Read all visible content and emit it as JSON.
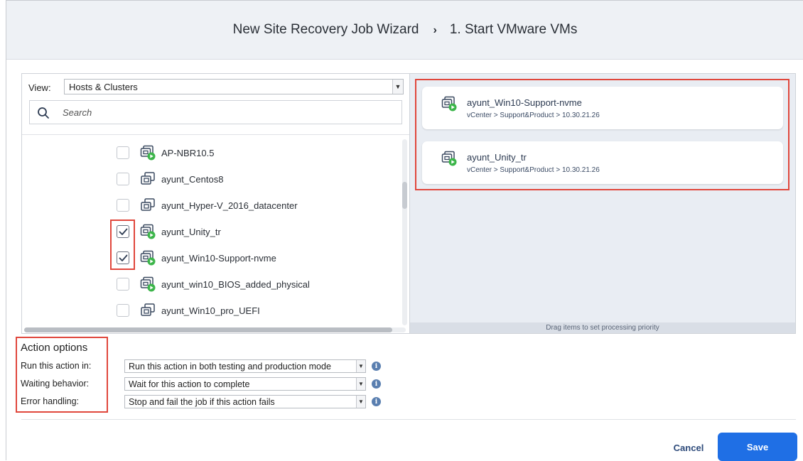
{
  "header": {
    "wizard_title": "New Site Recovery Job Wizard",
    "separator": "›",
    "step_title": "1. Start VMware VMs"
  },
  "inventory": {
    "view_label": "View:",
    "view_value": "Hosts & Clusters",
    "search_placeholder": "Search",
    "items": [
      {
        "name": "AP-NBR10.5",
        "checked": false,
        "powered_on": true
      },
      {
        "name": "ayunt_Centos8",
        "checked": false,
        "powered_on": false
      },
      {
        "name": "ayunt_Hyper-V_2016_datacenter",
        "checked": false,
        "powered_on": false
      },
      {
        "name": "ayunt_Unity_tr",
        "checked": true,
        "powered_on": true
      },
      {
        "name": "ayunt_Win10-Support-nvme",
        "checked": true,
        "powered_on": true
      },
      {
        "name": "ayunt_win10_BIOS_added_physical",
        "checked": false,
        "powered_on": true
      },
      {
        "name": "ayunt_Win10_pro_UEFI",
        "checked": false,
        "powered_on": false
      }
    ]
  },
  "selected": {
    "items": [
      {
        "name": "ayunt_Win10-Support-nvme",
        "path": "vCenter > Support&Product > 10.30.21.26"
      },
      {
        "name": "ayunt_Unity_tr",
        "path": "vCenter > Support&Product > 10.30.21.26"
      }
    ],
    "drag_hint": "Drag items to set processing priority"
  },
  "action_options": {
    "title": "Action options",
    "run_label": "Run this action in:",
    "run_value": "Run this action in both testing and production mode",
    "waiting_label": "Waiting behavior:",
    "waiting_value": "Wait for this action to complete",
    "error_label": "Error handling:",
    "error_value": "Stop and fail the job if this action fails"
  },
  "footer": {
    "cancel_label": "Cancel",
    "save_label": "Save"
  },
  "colors": {
    "accent": "#1f6fe5",
    "highlight": "#e0473c",
    "power_on": "#3cb54a"
  }
}
